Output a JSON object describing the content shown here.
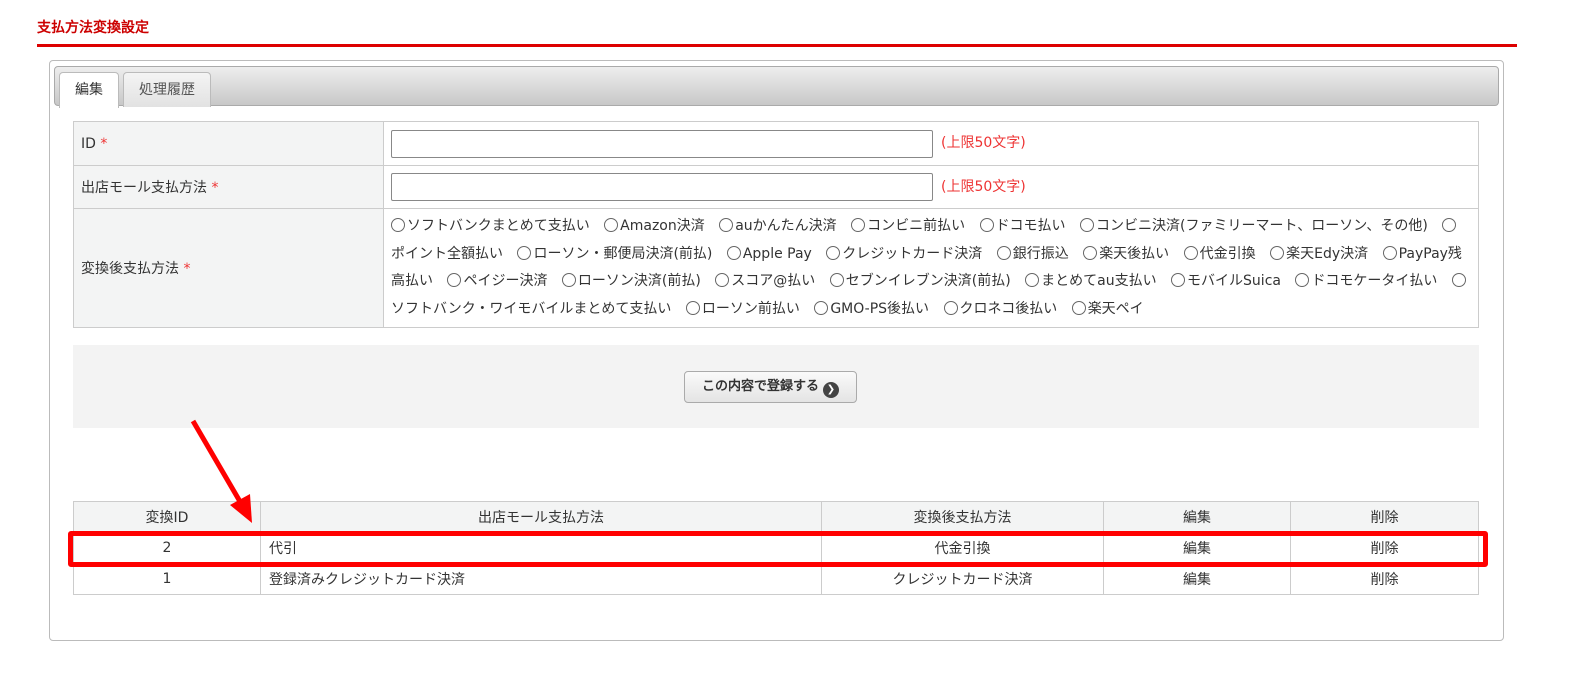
{
  "page_title": "支払方法変換設定",
  "tabs": [
    {
      "label": "編集"
    },
    {
      "label": "処理履歴"
    }
  ],
  "form": {
    "id_label": "ID",
    "required_mark": "*",
    "limit_note": "(上限50文字)",
    "mall_label": "出店モール支払方法",
    "id_value": "",
    "mall_value": "",
    "converted_label": "変換後支払方法",
    "options": [
      "ソフトバンクまとめて支払い",
      "Amazon決済",
      "auかんたん決済",
      "コンビニ前払い",
      "ドコモ払い",
      "コンビニ決済(ファミリーマート、ローソン、その他)",
      "ポイント全額払い",
      "ローソン・郵便局決済(前払)",
      "Apple Pay",
      "クレジットカード決済",
      "銀行振込",
      "楽天後払い",
      "代金引換",
      "楽天Edy決済",
      "PayPay残高払い",
      "ペイジー決済",
      "ローソン決済(前払)",
      "スコア@払い",
      "セブンイレブン決済(前払)",
      "まとめてau支払い",
      "モバイルSuica",
      "ドコモケータイ払い",
      "ソフトバンク・ワイモバイルまとめて支払い",
      "ローソン前払い",
      "GMO-PS後払い",
      "クロネコ後払い",
      "楽天ペイ"
    ]
  },
  "submit_label": "この内容で登録する",
  "list": {
    "headers": [
      "変換ID",
      "出店モール支払方法",
      "変換後支払方法",
      "編集",
      "削除"
    ],
    "rows": [
      {
        "id": "2",
        "mall": "代引",
        "converted": "代金引換",
        "edit": "編集",
        "delete": "削除"
      },
      {
        "id": "1",
        "mall": "登録済みクレジットカード決済",
        "converted": "クレジットカード決済",
        "edit": "編集",
        "delete": "削除"
      }
    ]
  },
  "colors": {
    "accent": "#dd0000",
    "highlight": "#ff0000"
  }
}
